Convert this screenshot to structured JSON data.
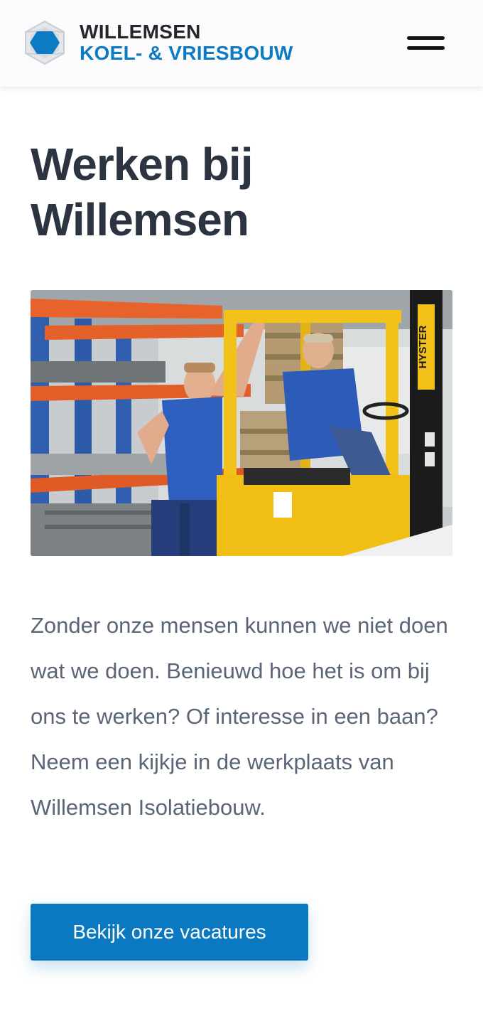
{
  "header": {
    "logo_line1": "WILLEMSEN",
    "logo_line2": "KOEL- & VRIESBOUW",
    "logo_icon": "hexagon-logo-icon",
    "menu_icon": "hamburger-menu-icon"
  },
  "main": {
    "title": "Werken bij Willemsen",
    "photo_forklift_brand": "HYSTER",
    "intro": "Zonder onze mensen kunnen we niet doen wat we doen. Benieuwd hoe het is om bij ons te werken? Of interesse in een baan? Neem een kijkje in de werkplaats van Willemsen Isolatiebouw.",
    "cta_label": "Bekijk onze vacatures"
  },
  "colors": {
    "brand_blue": "#0b79c1",
    "heading": "#2b3440",
    "body_text": "#5a6677",
    "header_bg": "#fbfbfb"
  }
}
